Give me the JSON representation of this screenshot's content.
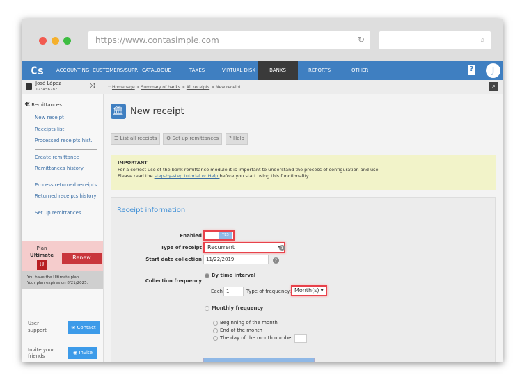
{
  "browser": {
    "url": "https://www.contasimple.com"
  },
  "nav": {
    "logo": "Cs",
    "items": [
      "ACCOUNTING",
      "CUSTOMERS/SUPP.",
      "CATALOGUE",
      "TAXES",
      "VIRTUAL DISK",
      "BANKS",
      "REPORTS",
      "OTHER"
    ],
    "active": "BANKS",
    "avatar": "J",
    "help": "?"
  },
  "user": {
    "name": "José López",
    "id": "12345678Z"
  },
  "breadcrumb": {
    "prefix": "::",
    "items": [
      "Homepage",
      "Summary of banks",
      "All receipts"
    ],
    "current": "New receipt"
  },
  "sidebar": {
    "section": "Remittances",
    "groups": [
      [
        "New receipt",
        "Receipts list",
        "Processed receipts hist."
      ],
      [
        "Create remittance",
        "Remittances history"
      ],
      [
        "Process returned receipts",
        "Returned receipts history"
      ],
      [
        "Set up remittances"
      ]
    ]
  },
  "plan": {
    "label": "Plan",
    "name": "Ultimate",
    "badge": "U",
    "renew": "Renew",
    "info1": "You have the Ultimate plan.",
    "info2": "Your plan expires on 8/21/2025."
  },
  "support": {
    "label": "User support",
    "contact": "Contact",
    "invite_label": "Invite your friends",
    "invite": "Invite"
  },
  "page": {
    "title": "New receipt",
    "buttons": [
      "List all receipts",
      "Set up remittances",
      "Help"
    ]
  },
  "notice": {
    "title": "IMPORTANT",
    "line1": "For a correct use of the bank remittance module it is important to understand the process of configuration and use.",
    "line2a": "Please read the ",
    "link": "step-by-step tutorial or Help ",
    "line2b": "before you start using this functionality."
  },
  "form": {
    "title": "Receipt information",
    "enabled_label": "Enabled",
    "toggle": "YES",
    "enabled": true,
    "type_label": "Type of receipt",
    "type_value": "Recurrent",
    "start_label": "Start date collection",
    "start_value": "11/22/2019",
    "freq_label": "Collection frequency",
    "by_interval": "By time interval",
    "each": "Each",
    "each_value": "1",
    "freq_type_label": "Type of frequency:",
    "freq_type_value": "Month(s)",
    "monthly": "Monthly frequency",
    "opt1": "Beginning of the month",
    "opt2": "End of the month",
    "opt3": "The day of the month number"
  },
  "colors": {
    "brand": "#3f7fc1",
    "active_nav": "#3a3a3a",
    "renew": "#c9363c",
    "highlight": "#e8424b"
  }
}
